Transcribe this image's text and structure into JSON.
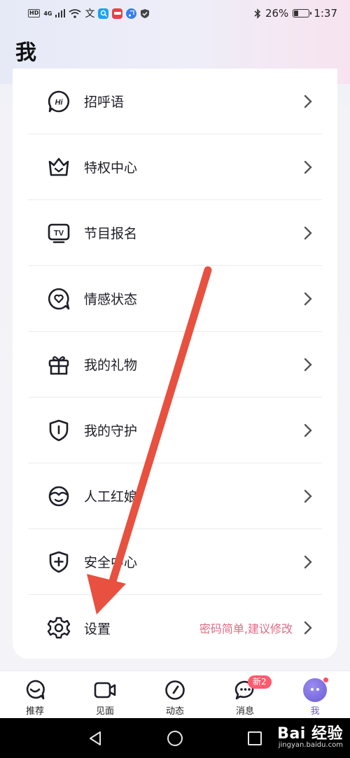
{
  "status_bar": {
    "hd_label": "HD",
    "network_label": "4G",
    "app_label": "文",
    "battery_text": "26%",
    "battery_level": 0.26,
    "time": "1:37"
  },
  "page": {
    "title": "我"
  },
  "menu": {
    "items": [
      {
        "label": "招呼语",
        "icon": "hi-icon"
      },
      {
        "label": "特权中心",
        "icon": "crown-icon"
      },
      {
        "label": "节目报名",
        "icon": "tv-icon"
      },
      {
        "label": "情感状态",
        "icon": "heart-bubble-icon"
      },
      {
        "label": "我的礼物",
        "icon": "gift-icon"
      },
      {
        "label": "我的守护",
        "icon": "shield-icon"
      },
      {
        "label": "人工红娘",
        "icon": "matchmaker-icon"
      },
      {
        "label": "安全中心",
        "icon": "shield-plus-icon"
      },
      {
        "label": "设置",
        "icon": "gear-icon",
        "hint": "密码简单,建议修改"
      }
    ]
  },
  "bottom_nav": {
    "tabs": [
      {
        "label": "推荐",
        "icon": "heart-bubble-icon"
      },
      {
        "label": "见面",
        "icon": "video-camera-icon"
      },
      {
        "label": "动态",
        "icon": "compass-icon"
      },
      {
        "label": "消息",
        "icon": "chat-icon",
        "badge": "新2"
      },
      {
        "label": "我",
        "icon": "avatar-icon",
        "active": true
      }
    ]
  },
  "watermark": {
    "main": "Bai 经验",
    "sub": "jingyan.baidu.com"
  },
  "colors": {
    "accent": "#6b5bd6",
    "hint": "#e06b83",
    "badge": "#ff5a6e",
    "arrow": "#e8503f"
  }
}
